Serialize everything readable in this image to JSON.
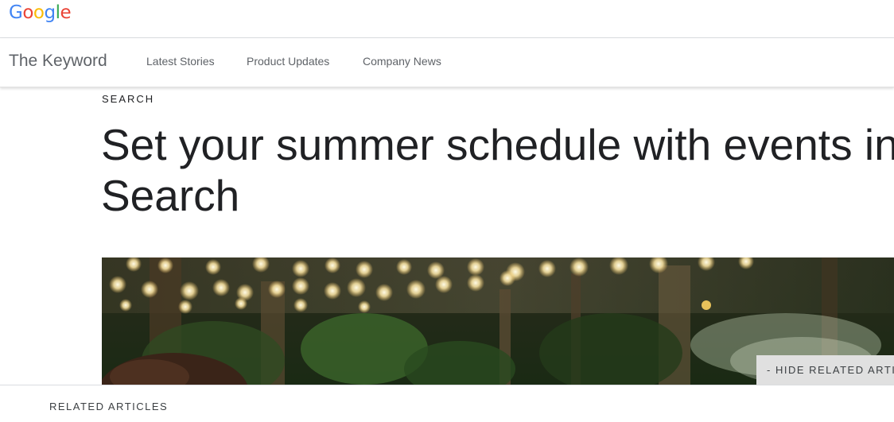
{
  "header": {
    "logo_letters": [
      {
        "char": "G",
        "color": "#4285F4"
      },
      {
        "char": "o",
        "color": "#EA4335"
      },
      {
        "char": "o",
        "color": "#FBBC05"
      },
      {
        "char": "g",
        "color": "#4285F4"
      },
      {
        "char": "l",
        "color": "#34A853"
      },
      {
        "char": "e",
        "color": "#EA4335"
      }
    ]
  },
  "nav": {
    "site_title": "The Keyword",
    "links": [
      "Latest Stories",
      "Product Updates",
      "Company News"
    ]
  },
  "article": {
    "category": "SEARCH",
    "headline_line1": "Set your summer schedule with events in",
    "headline_line2": "Search",
    "hero_image_icon": "string-lights-photo"
  },
  "related": {
    "toggle_label": "- HIDE RELATED ARTICLES",
    "section_label": "RELATED ARTICLES"
  }
}
